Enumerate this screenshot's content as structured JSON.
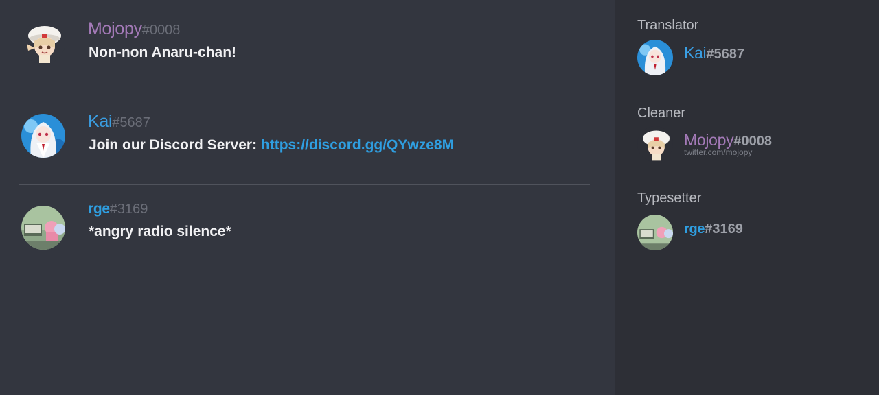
{
  "colors": {
    "chat_bg": "#33363f",
    "sidebar_bg": "#2d2f36",
    "mojopy": "#a47ab8",
    "kai": "#3a9ee2",
    "rge": "#2f9ee0",
    "link": "#2f9ee0"
  },
  "messages": [
    {
      "username": "Mojopy",
      "tag": "#0008",
      "text": "Non-non Anaru-chan!",
      "avatar_icon": "chibi-white-hat-avatar"
    },
    {
      "username": "Kai",
      "tag": "#5687",
      "text_prefix": "Join our Discord Server: ",
      "link": "https://discord.gg/QYwze8M",
      "avatar_icon": "white-hair-girl-avatar"
    },
    {
      "username": "rge",
      "tag": "#3169",
      "text": "*angry radio silence*",
      "avatar_icon": "green-scene-avatar"
    }
  ],
  "credits": [
    {
      "role": "Translator",
      "username": "Kai",
      "tag": "#5687"
    },
    {
      "role": "Cleaner",
      "username": "Mojopy",
      "tag": "#0008",
      "subtitle": "twitter.com/mojopy"
    },
    {
      "role": "Typesetter",
      "username": "rge",
      "tag": "#3169"
    }
  ]
}
